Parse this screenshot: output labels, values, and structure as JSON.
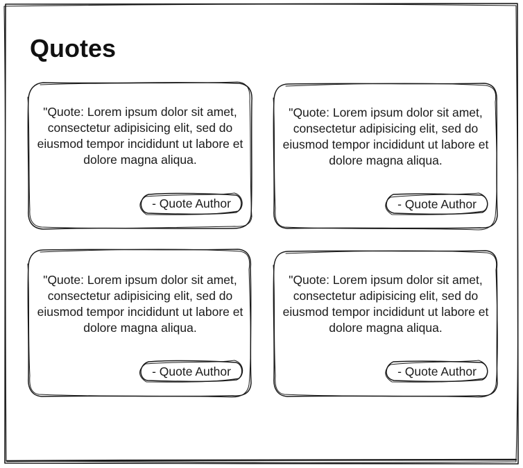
{
  "page": {
    "title": "Quotes"
  },
  "quotes": [
    {
      "text": "\"Quote: Lorem ipsum dolor sit amet, consectetur adipisicing elit, sed do eiusmod tempor incididunt ut labore et dolore magna aliqua.",
      "author": "- Quote Author"
    },
    {
      "text": "\"Quote: Lorem ipsum dolor sit amet, consectetur adipisicing elit, sed do eiusmod tempor incididunt ut labore et dolore magna aliqua.",
      "author": "- Quote Author"
    },
    {
      "text": "\"Quote: Lorem ipsum dolor sit amet, consectetur adipisicing elit, sed do eiusmod tempor incididunt ut labore et dolore magna aliqua.",
      "author": "- Quote Author"
    },
    {
      "text": "\"Quote: Lorem ipsum dolor sit amet, consectetur adipisicing elit, sed do eiusmod tempor incididunt ut labore et dolore magna aliqua.",
      "author": "- Quote Author"
    }
  ],
  "colors": {
    "stroke": "#1a1a1a",
    "background": "#ffffff"
  }
}
